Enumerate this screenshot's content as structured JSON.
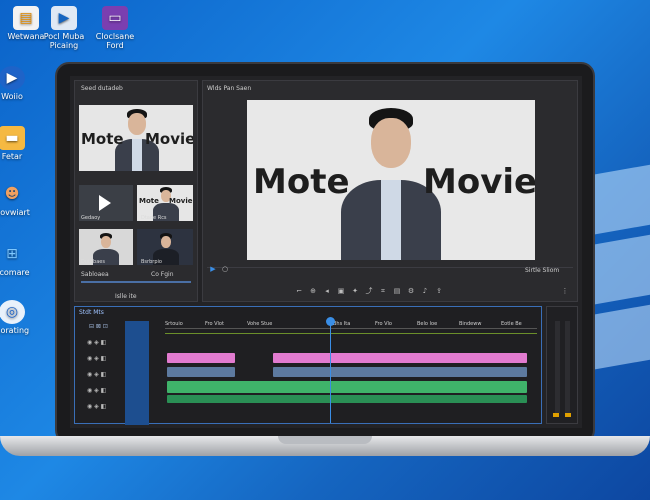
{
  "desktop": {
    "icons": [
      {
        "label": "Wetwana",
        "icon": "document-icon"
      },
      {
        "label": "Pocl Muba Picaing",
        "icon": "video-file-icon"
      },
      {
        "label": "Cloclsane Ford",
        "icon": "tv-app-icon"
      },
      {
        "label": "Woiio",
        "icon": "play-circle-icon"
      },
      {
        "label": "Fetar",
        "icon": "folder-icon"
      },
      {
        "label": "Dovwiart",
        "icon": "users-icon"
      },
      {
        "label": "Scomare",
        "icon": "windows-icon"
      },
      {
        "label": "Corating",
        "icon": "settings-circle-icon"
      }
    ]
  },
  "editor": {
    "media_bin": {
      "title": "Seed dutadeb",
      "thumbnails": [
        {
          "label": "Mote Movie"
        },
        {
          "label": "Gedaoy"
        },
        {
          "label": "Dtade Rcs"
        },
        {
          "label": "Dutobaes"
        },
        {
          "label": "Bsrbrpio"
        }
      ],
      "footer_left": "Sabloaea",
      "footer_right": "Co Fgin",
      "control_text": "Islle ite"
    },
    "program": {
      "title": "Wlds Pan Saen",
      "title_left": "Mote",
      "title_right": "Movie",
      "controls_right": "Sirtle Sliom"
    },
    "timeline": {
      "title": "Stdt Mts",
      "ruler_labels": [
        "Srtouio",
        "Fro Vlot",
        "Vohe Stue",
        "Bhs Ita",
        "Fro Vlo",
        "Belo Ioe",
        "Bindeww",
        "Eotle Be"
      ]
    }
  }
}
